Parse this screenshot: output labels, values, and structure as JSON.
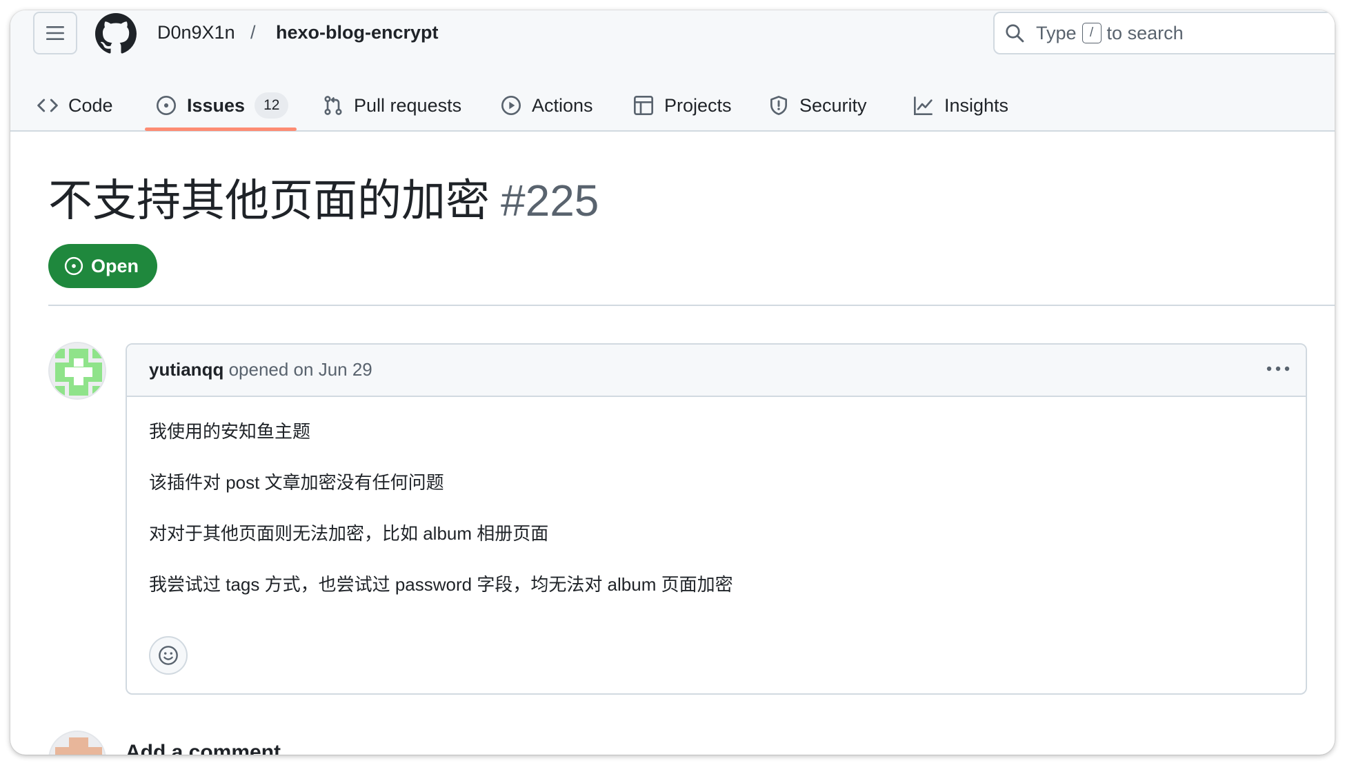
{
  "header": {
    "owner": "D0n9X1n",
    "separator": "/",
    "repo": "hexo-blog-encrypt",
    "search": {
      "prefix": "Type",
      "key": "/",
      "suffix": "to search"
    }
  },
  "tabs": [
    {
      "label": "Code",
      "icon": "code-icon"
    },
    {
      "label": "Issues",
      "icon": "issue-opened-icon",
      "count": "12",
      "active": true
    },
    {
      "label": "Pull requests",
      "icon": "git-pull-request-icon"
    },
    {
      "label": "Actions",
      "icon": "play-icon"
    },
    {
      "label": "Projects",
      "icon": "table-icon"
    },
    {
      "label": "Security",
      "icon": "shield-icon"
    },
    {
      "label": "Insights",
      "icon": "graph-icon"
    }
  ],
  "issue": {
    "title": "不支持其他页面的加密",
    "number": "#225",
    "status": "Open"
  },
  "comment": {
    "author": "yutianqq",
    "action": "opened on Jun 29",
    "paragraphs": [
      "我使用的安知鱼主题",
      "该插件对 post 文章加密没有任何问题",
      "对对于其他页面则无法加密，比如 album 相册页面",
      "我尝试过 tags 方式，也尝试过 password 字段，均无法对 album 页面加密"
    ]
  },
  "footer": {
    "add_comment": "Add a comment"
  },
  "colors": {
    "accent_underline": "#fd8c73",
    "open_green": "#1f883d",
    "avatar_green": "#8fe38a",
    "avatar_orange": "#e8b69a"
  }
}
